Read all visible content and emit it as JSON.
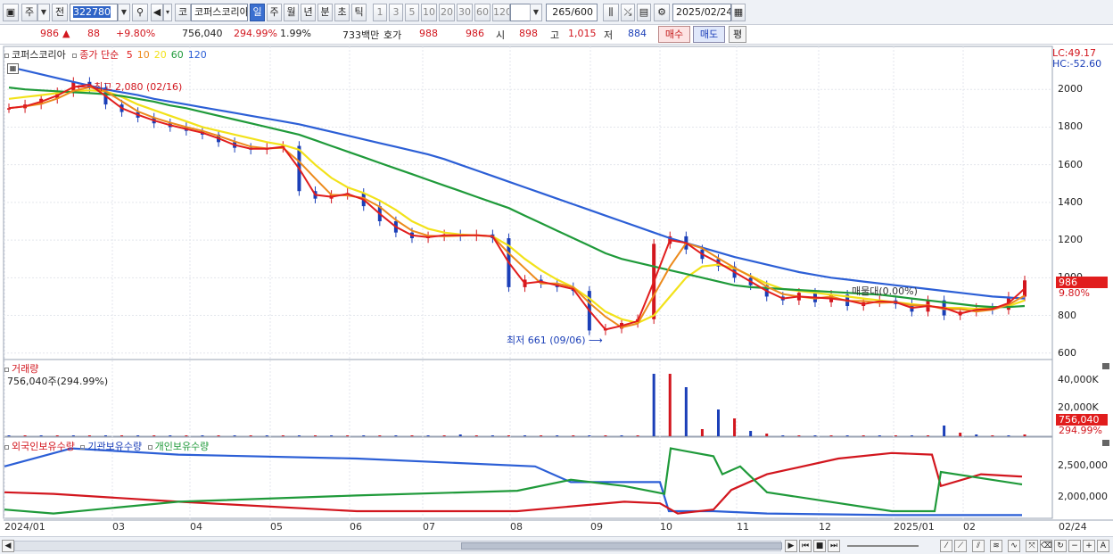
{
  "toolbar": {
    "type_label": "주",
    "prev_label": "전",
    "code": "322780",
    "code_type": "코",
    "stock_name": "코퍼스코리아",
    "periods": [
      "일",
      "주",
      "월",
      "년",
      "분",
      "초",
      "틱"
    ],
    "active_period": "일",
    "intervals": [
      "1",
      "3",
      "5",
      "10",
      "20",
      "30",
      "60",
      "120"
    ],
    "count_value": "265",
    "count_total": "/600",
    "date": "2025/02/24"
  },
  "quote": {
    "price": "986",
    "change_arrow": "▲",
    "change": "88",
    "change_pct": "+9.80%",
    "volume": "756,040",
    "volume_pct": "294.99%",
    "turnover": "1.99%",
    "amount": "733백만",
    "ask_label": "호가",
    "ask": "988",
    "bid": "986",
    "open_label": "시",
    "open": "898",
    "high_label": "고",
    "high": "1,015",
    "low_label": "저",
    "low": "884",
    "buy_label": "매수",
    "sell_label": "매도",
    "flat_label": "평"
  },
  "legend": {
    "name": "코퍼스코리아",
    "price_label": "종가 단순",
    "ma": [
      {
        "label": "5",
        "color": "#e11d1d"
      },
      {
        "label": "10",
        "color": "#ec8a1c"
      },
      {
        "label": "20",
        "color": "#f2e21a"
      },
      {
        "label": "60",
        "color": "#1f9a3a"
      },
      {
        "label": "120",
        "color": "#2c5fd6"
      }
    ]
  },
  "right_info": {
    "lc": "LC:49.17",
    "hc": "HC:-52.60"
  },
  "annotations": {
    "high": "최고 2,080 (02/16)",
    "low": "최저 661 (09/06)",
    "ratio": "매물대(0.00%)"
  },
  "price_tags": {
    "price": "986",
    "pct": "9.80%"
  },
  "volume_panel": {
    "title": "거래량",
    "value": "756,040주(294.99%)",
    "tag_value": "756,040",
    "tag_pct": "294.99%",
    "yticks": [
      "40,000K",
      "20,000K"
    ]
  },
  "holders_panel": {
    "series": [
      {
        "label": "외국인보유수량",
        "color": "#d2161e"
      },
      {
        "label": "기관보유수량",
        "color": "#2c5fd6"
      },
      {
        "label": "개인보유수량",
        "color": "#1f9a3a"
      }
    ],
    "yticks": [
      "2,500,000",
      "2,000,000"
    ]
  },
  "x_labels": [
    "2024/01",
    "03",
    "04",
    "05",
    "06",
    "07",
    "08",
    "09",
    "10",
    "11",
    "12",
    "2025/01",
    "02"
  ],
  "x_last": "02/24",
  "chart_data": {
    "type": "line",
    "title": "",
    "y_ticks": [
      2000,
      1800,
      1600,
      1400,
      1200,
      1000,
      800,
      600
    ],
    "ylim": [
      580,
      2200
    ],
    "close_series": [
      1900,
      1920,
      1950,
      1985,
      2040,
      2010,
      1920,
      1880,
      1850,
      1820,
      1800,
      1780,
      1760,
      1720,
      1690,
      1680,
      1690,
      1700,
      1460,
      1420,
      1440,
      1450,
      1380,
      1300,
      1240,
      1210,
      1220,
      1230,
      1220,
      1230,
      1210,
      950,
      990,
      970,
      950,
      930,
      720,
      730,
      760,
      780,
      1180,
      1220,
      1150,
      1100,
      1060,
      1000,
      960,
      900,
      880,
      920,
      870,
      910,
      850,
      870,
      880,
      860,
      820,
      880,
      800,
      820,
      840,
      830,
      900,
      986
    ],
    "ma_series": {
      "20": [
        1950,
        1960,
        1970,
        1980,
        1990,
        1995,
        1990,
        1960,
        1920,
        1890,
        1860,
        1830,
        1800,
        1780,
        1760,
        1740,
        1720,
        1705,
        1680,
        1600,
        1530,
        1480,
        1450,
        1410,
        1360,
        1300,
        1260,
        1240,
        1230,
        1225,
        1220,
        1170,
        1100,
        1040,
        990,
        950,
        890,
        820,
        780,
        760,
        800,
        900,
        1000,
        1060,
        1070,
        1050,
        1010,
        970,
        940,
        930,
        920,
        910,
        900,
        890,
        880,
        870,
        860,
        850,
        840,
        840,
        835,
        840,
        850,
        880
      ],
      "60": [
        2010,
        2000,
        1995,
        1990,
        1985,
        1980,
        1975,
        1965,
        1950,
        1935,
        1915,
        1900,
        1880,
        1860,
        1840,
        1820,
        1800,
        1780,
        1760,
        1730,
        1700,
        1670,
        1640,
        1610,
        1580,
        1550,
        1520,
        1490,
        1460,
        1430,
        1400,
        1370,
        1330,
        1290,
        1250,
        1210,
        1170,
        1130,
        1100,
        1080,
        1060,
        1040,
        1020,
        1000,
        980,
        960,
        950,
        945,
        940,
        935,
        930,
        925,
        920,
        915,
        910,
        900,
        890,
        880,
        870,
        860,
        850,
        845,
        845,
        850
      ],
      "120": [
        2120,
        2100,
        2080,
        2060,
        2040,
        2020,
        2000,
        1985,
        1970,
        1950,
        1935,
        1920,
        1905,
        1890,
        1875,
        1860,
        1845,
        1830,
        1815,
        1795,
        1775,
        1755,
        1735,
        1715,
        1695,
        1675,
        1655,
        1630,
        1600,
        1570,
        1540,
        1510,
        1480,
        1450,
        1420,
        1390,
        1360,
        1330,
        1300,
        1270,
        1240,
        1210,
        1185,
        1160,
        1135,
        1110,
        1090,
        1070,
        1050,
        1030,
        1015,
        1000,
        990,
        980,
        970,
        960,
        950,
        940,
        930,
        920,
        910,
        900,
        895,
        890
      ]
    }
  }
}
